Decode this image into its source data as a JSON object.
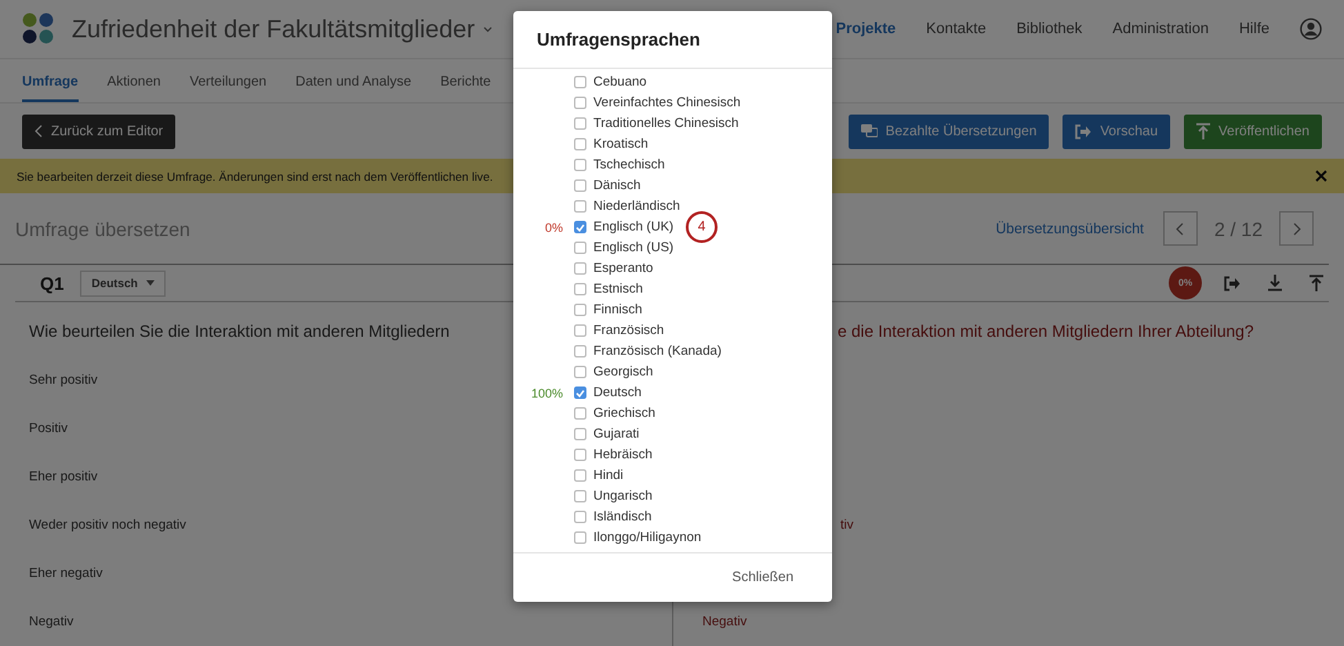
{
  "header": {
    "title": "Zufriedenheit der Fakultätsmitglieder",
    "nav": [
      {
        "label": "Projekte",
        "selected": true
      },
      {
        "label": "Kontakte",
        "selected": false
      },
      {
        "label": "Bibliothek",
        "selected": false
      },
      {
        "label": "Administration",
        "selected": false
      },
      {
        "label": "Hilfe",
        "selected": false
      }
    ]
  },
  "tabs": [
    {
      "label": "Umfrage",
      "selected": true
    },
    {
      "label": "Aktionen",
      "selected": false
    },
    {
      "label": "Verteilungen",
      "selected": false
    },
    {
      "label": "Daten und Analyse",
      "selected": false
    },
    {
      "label": "Berichte",
      "selected": false
    }
  ],
  "toolbar": {
    "back": "Zurück zum Editor",
    "actions": [
      {
        "label": "Bezahlte Übersetzungen",
        "kind": "paid"
      },
      {
        "label": "Vorschau",
        "kind": "preview"
      },
      {
        "label": "Veröffentlichen",
        "kind": "publish"
      }
    ]
  },
  "banner": {
    "text": "Sie bearbeiten derzeit diese Umfrage. Änderungen sind erst nach dem Veröffentlichen live."
  },
  "section": {
    "title": "Umfrage übersetzen",
    "overview_link": "Übersetzungsübersicht",
    "pager": "2 / 12"
  },
  "question": {
    "id": "Q1",
    "language": "Deutsch",
    "progress": "0%",
    "source_text": "Wie beurteilen Sie die Interaktion mit anderen Mitgliedern",
    "translated_text": {
      "text": "e die Interaktion mit anderen Mitgliedern Ihrer Abteilung?",
      "clipped": true
    },
    "answers": [
      {
        "source": "Sehr positiv"
      },
      {
        "source": "Positiv"
      },
      {
        "source": "Eher positiv"
      },
      {
        "source": "Weder positiv noch negativ",
        "translation": {
          "text": "tiv",
          "clipped": true
        }
      },
      {
        "source": "Eher negativ"
      },
      {
        "source": "Negativ",
        "translation": {
          "text": "Negativ"
        }
      }
    ]
  },
  "dialog": {
    "title": "Umfragensprachen",
    "close": "Schließen",
    "languages": [
      {
        "name": "Cebuano",
        "checked": false
      },
      {
        "name": "Vereinfachtes Chinesisch",
        "checked": false
      },
      {
        "name": "Traditionelles Chinesisch",
        "checked": false
      },
      {
        "name": "Kroatisch",
        "checked": false
      },
      {
        "name": "Tschechisch",
        "checked": false
      },
      {
        "name": "Dänisch",
        "checked": false
      },
      {
        "name": "Niederländisch",
        "checked": false
      },
      {
        "name": "Englisch (UK)",
        "checked": true,
        "percent": "0%",
        "color": "#c0392b",
        "callout": "4"
      },
      {
        "name": "Englisch (US)",
        "checked": false
      },
      {
        "name": "Esperanto",
        "checked": false
      },
      {
        "name": "Estnisch",
        "checked": false
      },
      {
        "name": "Finnisch",
        "checked": false
      },
      {
        "name": "Französisch",
        "checked": false
      },
      {
        "name": "Französisch (Kanada)",
        "checked": false
      },
      {
        "name": "Georgisch",
        "checked": false
      },
      {
        "name": "Deutsch",
        "checked": true,
        "percent": "100%",
        "color": "#4a8a2a"
      },
      {
        "name": "Griechisch",
        "checked": false
      },
      {
        "name": "Gujarati",
        "checked": false
      },
      {
        "name": "Hebräisch",
        "checked": false
      },
      {
        "name": "Hindi",
        "checked": false
      },
      {
        "name": "Ungarisch",
        "checked": false
      },
      {
        "name": "Isländisch",
        "checked": false
      },
      {
        "name": "Ilonggo/Hiligaynon",
        "checked": false
      }
    ]
  }
}
